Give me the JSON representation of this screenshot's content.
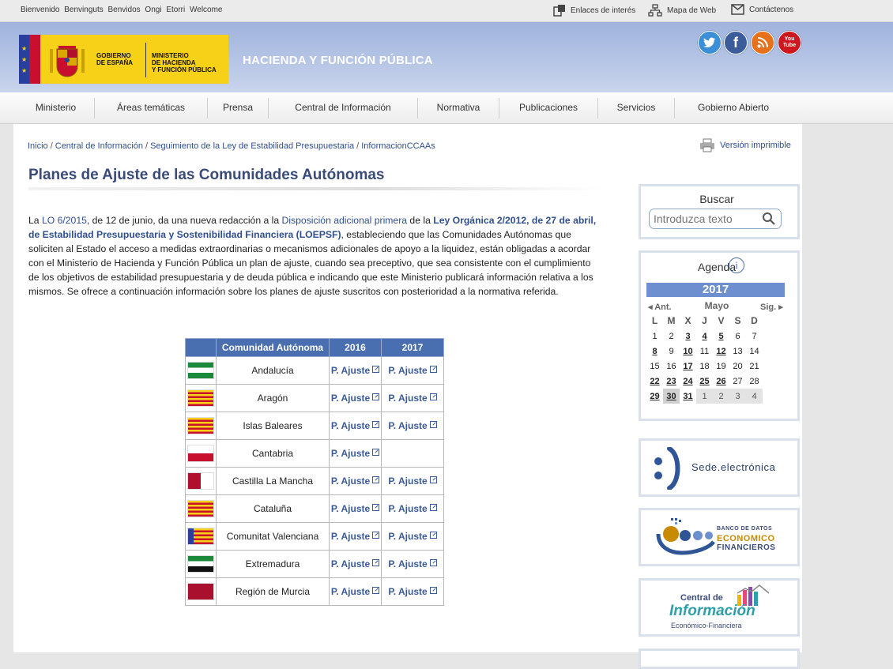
{
  "topbar": {
    "welcome": "Bienvenido Benvinguts Benvidos Ongi Etorri Welcome",
    "links": [
      "Enlaces de interés",
      "Mapa de Web",
      "Contáctenos"
    ]
  },
  "header": {
    "logo_gobierno": "GOBIERNO DE ESPAÑA",
    "logo_ministerio": "MINISTERIO DE HACIENDA Y FUNCIÓN PÚBLICA",
    "site_title": "HACIENDA Y FUNCIÓN PÚBLICA",
    "social": {
      "youtube": "You Tube"
    }
  },
  "nav": [
    "Ministerio",
    "Áreas temáticas",
    "Prensa",
    "Central de Información",
    "Normativa",
    "Publicaciones",
    "Servicios",
    "Gobierno Abierto"
  ],
  "breadcrumb": [
    "Inicio",
    "Central de Información",
    "Seguimiento de la Ley de Estabilidad Presupuestaria",
    "InformacionCCAAs"
  ],
  "printable": "Versión imprimible",
  "page_title": "Planes de Ajuste de las Comunidades Autónomas",
  "intro": {
    "t1": "La ",
    "l1": "LO 6/2015",
    "t2": ", de 12 de junio, da una nueva redacción a la ",
    "l2": "Disposición adicional primera",
    "t3": " de la ",
    "l3": "Ley Orgánica 2/2012, de 27 de abril, de Estabilidad Presupuestaria y Sostenibilidad Financiera (LOEPSF)",
    "t4": ", estableciendo que las Comunidades Autónomas que soliciten al Estado el acceso a medidas extraordinarias o mecanismos adicionales de apoyo a la liquidez, están obligadas a acordar con el Ministerio de Hacienda y Función Pública un plan de ajuste, cuando sea preceptivo, que sea consistente con el cumplimiento de los objetivos de estabilidad presupuestaria y de deuda pública e indicando que este Ministerio publicará información relativa a los mismos. Se ofrece a continuación información sobre los planes de ajuste suscritos con posterioridad a la normativa referida."
  },
  "table": {
    "headers": [
      "Comunidad Autónoma",
      "2016",
      "2017"
    ],
    "plan_label": "P. Ajuste",
    "rows": [
      {
        "name": "Andalucía",
        "y2016": true,
        "y2017": true
      },
      {
        "name": "Aragón",
        "y2016": true,
        "y2017": true
      },
      {
        "name": "Islas Baleares",
        "y2016": true,
        "y2017": true
      },
      {
        "name": "Cantabria",
        "y2016": true,
        "y2017": false
      },
      {
        "name": "Castilla La Mancha",
        "y2016": true,
        "y2017": true
      },
      {
        "name": "Cataluña",
        "y2016": true,
        "y2017": true
      },
      {
        "name": "Comunitat Valenciana",
        "y2016": true,
        "y2017": true
      },
      {
        "name": "Extremadura",
        "y2016": true,
        "y2017": true
      },
      {
        "name": "Región de Murcia",
        "y2016": true,
        "y2017": true
      }
    ]
  },
  "search": {
    "label": "Buscar",
    "placeholder": "Introduzca texto"
  },
  "agenda": {
    "label": "Agenda",
    "year": "2017",
    "month": "Mayo",
    "prev": "Ant.",
    "next": "Sig.",
    "weekdays": [
      "L",
      "M",
      "X",
      "J",
      "V",
      "S",
      "D"
    ],
    "weeks": [
      [
        "1",
        "2",
        "3",
        "4",
        "5",
        "6",
        "7"
      ],
      [
        "8",
        "9",
        "10",
        "11",
        "12",
        "13",
        "14"
      ],
      [
        "15",
        "16",
        "17",
        "18",
        "19",
        "20",
        "21"
      ],
      [
        "22",
        "23",
        "24",
        "25",
        "26",
        "27",
        "28"
      ],
      [
        "29",
        "30",
        "31",
        "1",
        "2",
        "3",
        "4"
      ]
    ],
    "event_days": [
      "3",
      "4",
      "5",
      "8",
      "10",
      "12",
      "17",
      "22",
      "23",
      "24",
      "25",
      "26",
      "29",
      "30",
      "31"
    ]
  },
  "sede": "Sede.electrónica",
  "banco": {
    "l1": "BANCO DE DATOS",
    "l2": "ECONOMICO",
    "l3": "FINANCIEROS"
  },
  "central": {
    "l1": "Central de",
    "l2": "Información",
    "l3": "Económico-Financiera"
  },
  "colors": {
    "accent": "#4a6fb0",
    "link": "#2f4f8f",
    "title": "#3a4b7a"
  }
}
